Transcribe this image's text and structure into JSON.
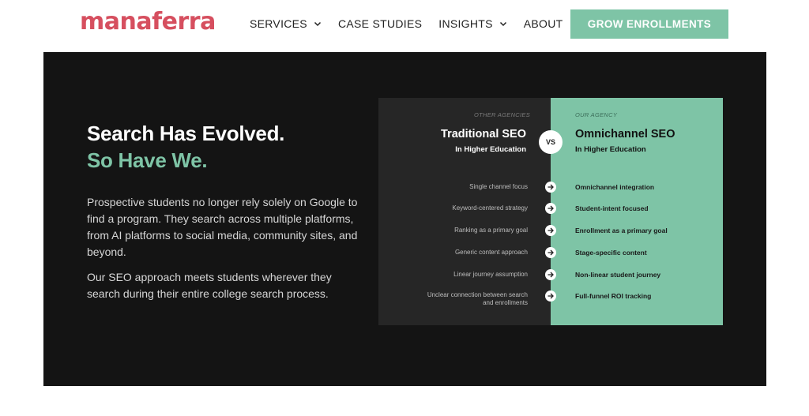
{
  "header": {
    "logo": "manaferra",
    "nav": [
      {
        "label": "SERVICES",
        "has_dropdown": true
      },
      {
        "label": "CASE STUDIES",
        "has_dropdown": false
      },
      {
        "label": "INSIGHTS",
        "has_dropdown": true
      },
      {
        "label": "ABOUT",
        "has_dropdown": false
      }
    ],
    "cta_label": "GROW ENROLLMENTS"
  },
  "hero": {
    "title_line1": "Search Has Evolved.",
    "title_line2": "So Have We.",
    "paragraph1": "Prospective students no longer rely solely on Google to find a program. They search across multiple platforms, from AI platforms to social media, community sites, and beyond.",
    "paragraph2": "Our SEO approach meets students wherever they search during their entire college search process."
  },
  "comparison": {
    "left_eyebrow": "OTHER AGENCIES",
    "left_heading": "Traditional SEO",
    "left_subheading": "In Higher Education",
    "vs_label": "VS",
    "right_eyebrow": "OUR AGENCY",
    "right_heading": "Omnichannel SEO",
    "right_subheading": "In Higher Education",
    "rows": [
      {
        "left": "Single channel focus",
        "right": "Omnichannel integration"
      },
      {
        "left": "Keyword-centered strategy",
        "right": "Student-intent focused"
      },
      {
        "left": "Ranking as a primary goal",
        "right": "Enrollment as a primary goal"
      },
      {
        "left": "Generic content approach",
        "right": "Stage-specific content"
      },
      {
        "left": "Linear journey assumption",
        "right": "Non-linear student journey"
      },
      {
        "left": "Unclear connection between search and enrollments",
        "right": "Full-funnel ROI tracking"
      }
    ]
  },
  "colors": {
    "brand": "#d64f5f",
    "accent": "#7ec4a6",
    "hero_bg": "#141414"
  },
  "icons": {
    "dropdown": "chevron-down-icon",
    "row_arrow": "arrow-right-icon"
  }
}
